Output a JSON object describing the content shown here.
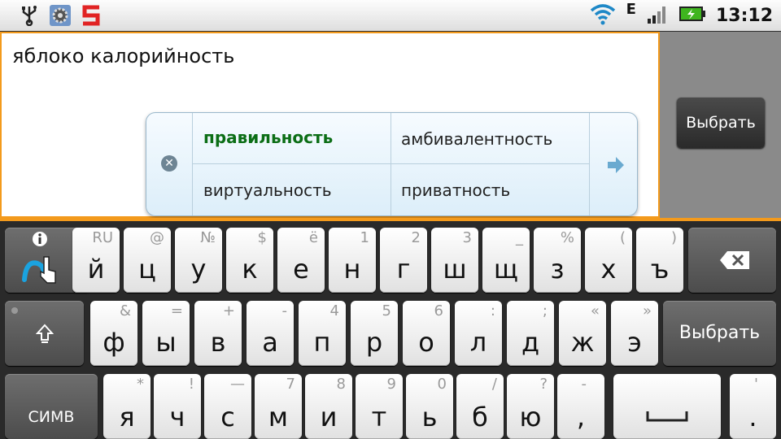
{
  "status_bar": {
    "icons_left": [
      "usb-icon",
      "settings-icon",
      "s-app-icon"
    ],
    "network_type": "E",
    "time": "13:12",
    "colors": {
      "battery": "#3fb51f",
      "wifi": "#1e88c7",
      "app": "#e12323"
    }
  },
  "text_field": {
    "value": "яблоко калорийность"
  },
  "select_button": {
    "label": "Выбрать"
  },
  "suggestions": {
    "items": [
      "правильность",
      "амбивалентность",
      "виртуальность",
      "приватность"
    ]
  },
  "keyboard": {
    "row1": [
      {
        "main": "й",
        "hint": "RU"
      },
      {
        "main": "ц",
        "hint": "@"
      },
      {
        "main": "у",
        "hint": "№"
      },
      {
        "main": "к",
        "hint": "$"
      },
      {
        "main": "е",
        "hint": "ё"
      },
      {
        "main": "н",
        "hint": "1"
      },
      {
        "main": "г",
        "hint": "2"
      },
      {
        "main": "ш",
        "hint": "3"
      },
      {
        "main": "щ",
        "hint": "_"
      },
      {
        "main": "з",
        "hint": "%"
      },
      {
        "main": "х",
        "hint": "("
      },
      {
        "main": "ъ",
        "hint": ")"
      }
    ],
    "row2": [
      {
        "main": "ф",
        "hint": "&"
      },
      {
        "main": "ы",
        "hint": "="
      },
      {
        "main": "в",
        "hint": "+"
      },
      {
        "main": "а",
        "hint": "-"
      },
      {
        "main": "п",
        "hint": "4"
      },
      {
        "main": "р",
        "hint": "5"
      },
      {
        "main": "о",
        "hint": "6"
      },
      {
        "main": "л",
        "hint": ":"
      },
      {
        "main": "д",
        "hint": ";"
      },
      {
        "main": "ж",
        "hint": "«"
      },
      {
        "main": "э",
        "hint": "»"
      }
    ],
    "row3": [
      {
        "main": "я",
        "hint": "*"
      },
      {
        "main": "ч",
        "hint": "!"
      },
      {
        "main": "с",
        "hint": "—"
      },
      {
        "main": "м",
        "hint": "7"
      },
      {
        "main": "и",
        "hint": "8"
      },
      {
        "main": "т",
        "hint": "9"
      },
      {
        "main": "ь",
        "hint": "0"
      },
      {
        "main": "б",
        "hint": "/"
      },
      {
        "main": "ю",
        "hint": "?"
      },
      {
        "main": ",",
        "hint": "-"
      }
    ],
    "period": {
      "main": ".",
      "hint": "'"
    },
    "action_label": "Выбрать",
    "symbols_label": "СИМВ"
  }
}
